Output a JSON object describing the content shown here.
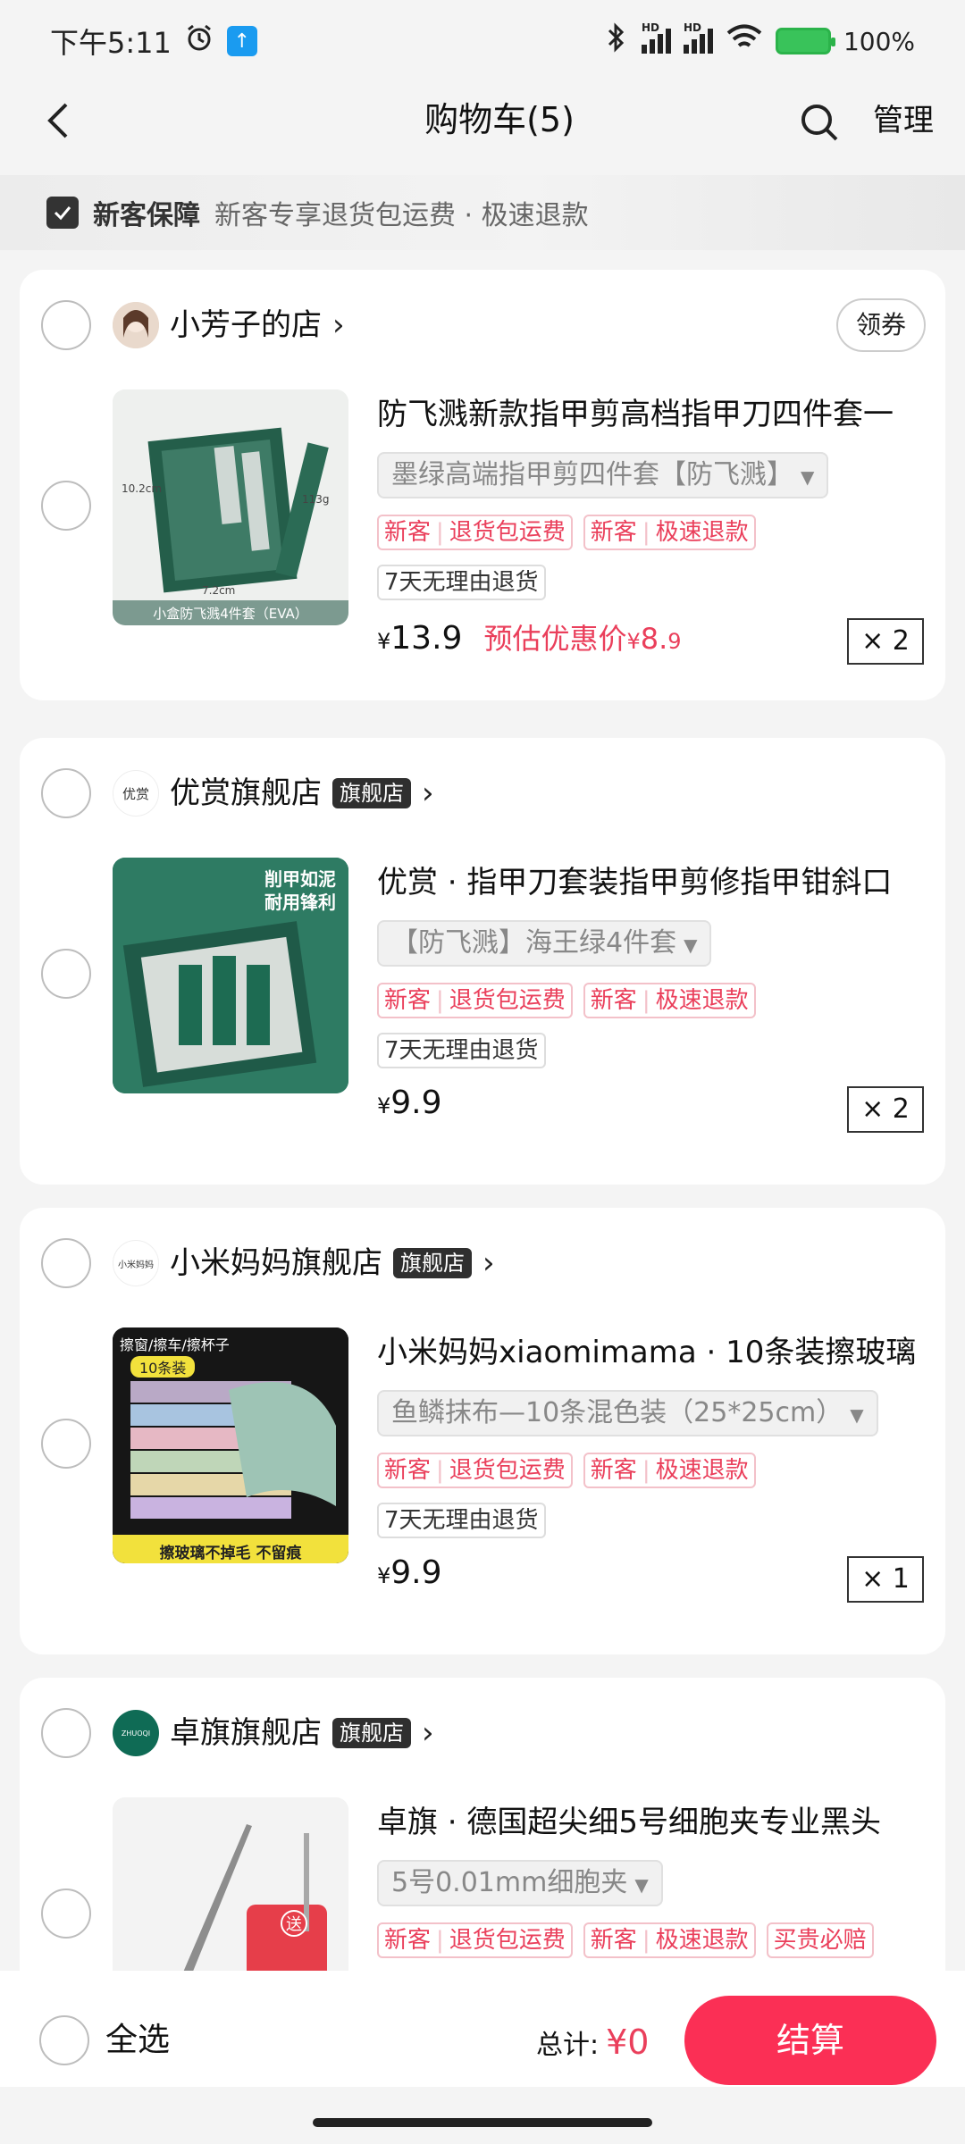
{
  "status_bar": {
    "time": "下午5:11",
    "hd1": "HD",
    "hd2": "HD",
    "battery": "100%"
  },
  "header": {
    "title": "购物车(5)",
    "manage_label": "管理"
  },
  "guarantee": {
    "title": "新客保障",
    "desc": "新客专享退货包运费 · 极速退款"
  },
  "stores": [
    {
      "name": "小芳子的店",
      "coupon_label": "领券",
      "product": {
        "title": "防飞溅新款指甲剪高档指甲刀四件套一",
        "sku": "墨绿高端指甲剪四件套【防飞溅】",
        "tag1_a": "新客",
        "tag1_b": "退货包运费",
        "tag2_a": "新客",
        "tag2_b": "极速退款",
        "return_tag": "7天无理由退货",
        "price_symbol": "¥",
        "price": "13.9",
        "promo_label": "预估优惠价",
        "promo_symbol": "¥",
        "promo_int": "8.",
        "promo_dec": "9",
        "qty": "× 2",
        "img_caption": "小盒防飞溅4件套（EVA）",
        "img_dim1": "10.2cm",
        "img_dim2": "7.2cm",
        "img_dim3": "113g"
      }
    },
    {
      "name": "优赏旗舰店",
      "badge": "旗舰店",
      "logo_text": "优赏",
      "product": {
        "title": "优赏 · 指甲刀套装指甲剪修指甲钳斜口",
        "sku": "【防飞溅】海王绿4件套",
        "tag1_a": "新客",
        "tag1_b": "退货包运费",
        "tag2_a": "新客",
        "tag2_b": "极速退款",
        "return_tag": "7天无理由退货",
        "price_symbol": "¥",
        "price": "9.9",
        "qty": "× 2",
        "img_line1": "削甲如泥",
        "img_line2": "耐用锋利"
      }
    },
    {
      "name": "小米妈妈旗舰店",
      "badge": "旗舰店",
      "logo_text": "小米妈妈",
      "product": {
        "title": "小米妈妈xiaomimama · 10条装擦玻璃",
        "sku": "鱼鳞抹布—10条混色装（25*25cm）",
        "tag1_a": "新客",
        "tag1_b": "退货包运费",
        "tag2_a": "新客",
        "tag2_b": "极速退款",
        "return_tag": "7天无理由退货",
        "price_symbol": "¥",
        "price": "9.9",
        "qty": "× 1",
        "img_top": "擦窗/擦车/擦杯子",
        "img_badge": "10条装",
        "img_bottom": "擦玻璃不掉毛 不留痕"
      }
    },
    {
      "name": "卓旗旗舰店",
      "badge": "旗舰店",
      "logo_text": "ZHUOQI",
      "product": {
        "title": "卓旗 · 德国超尖细5号细胞夹专业黑头",
        "sku": "5号0.01mm细胞夹",
        "tag1_a": "新客",
        "tag1_b": "退货包运费",
        "tag2_a": "新客",
        "tag2_b": "极速退款",
        "tag3": "买贵必赔",
        "img_badge": "送"
      }
    }
  ],
  "bottom": {
    "select_all": "全选",
    "total_label": "总计:",
    "total_symbol": "¥",
    "total_value": "0",
    "checkout": "结算"
  },
  "colors": {
    "accent": "#fb2f55",
    "tag_red": "#ea3f5b",
    "flag_badge": "#2f2f2f"
  }
}
